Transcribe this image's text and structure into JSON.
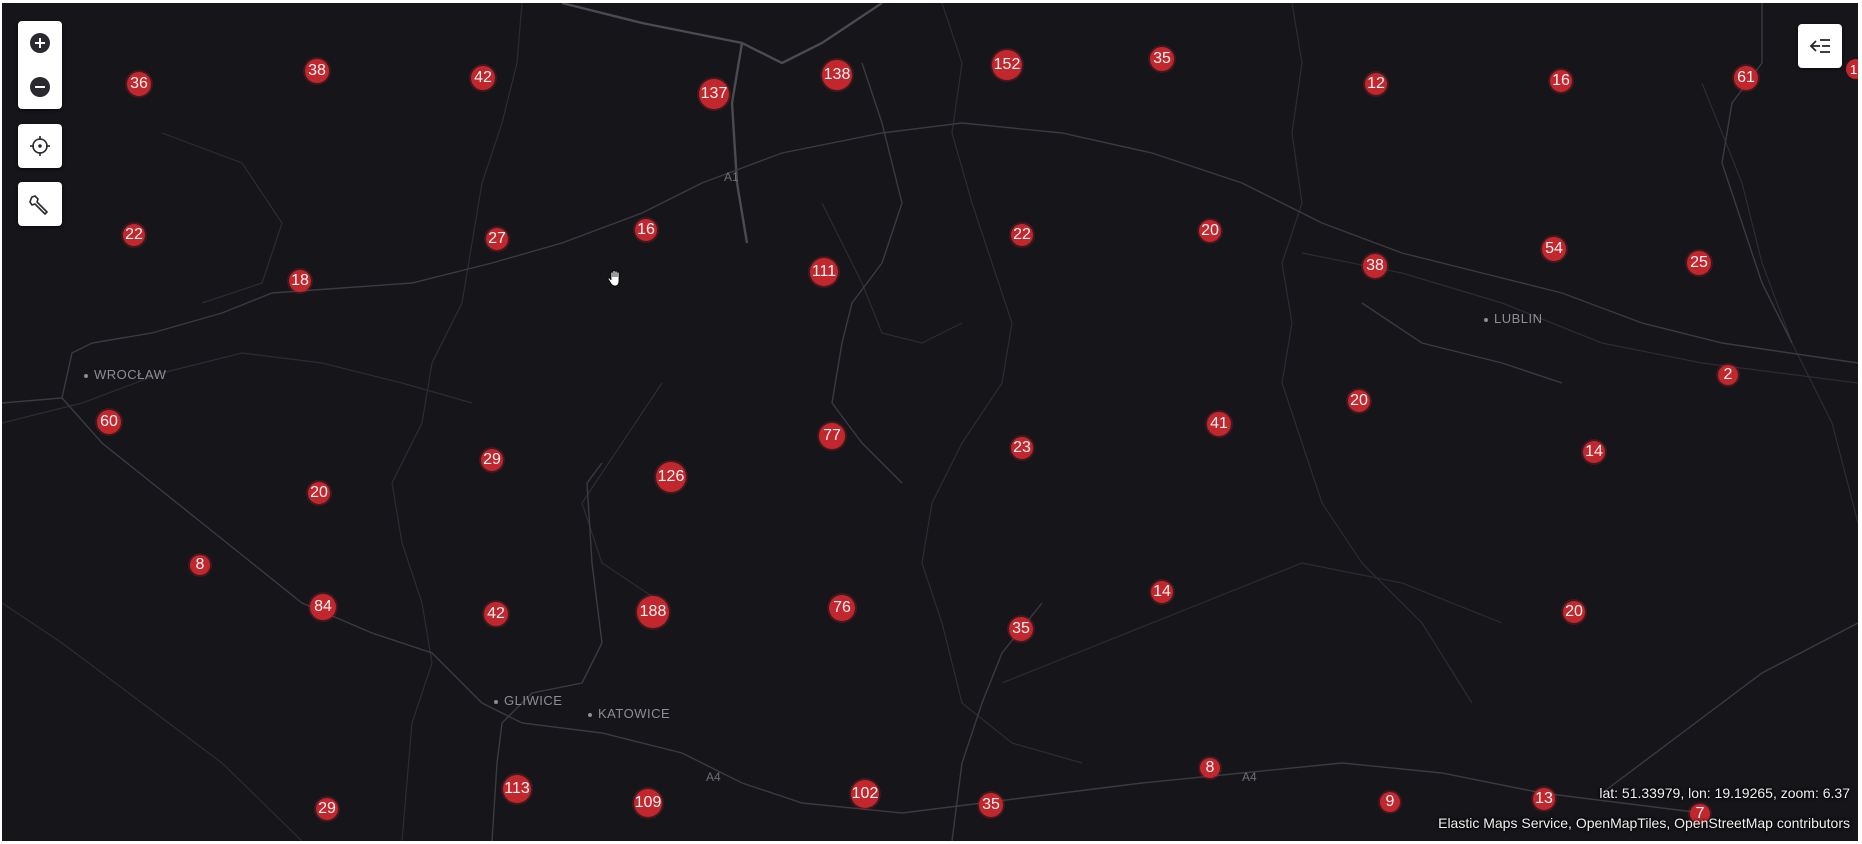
{
  "controls": {
    "zoom_in": "zoom-in-icon",
    "zoom_out": "zoom-out-icon",
    "locate": "crosshair-icon",
    "tools": "wrench-icon",
    "layers": "layers-toggle-icon"
  },
  "cities": [
    {
      "name": "WROCŁAW"
    },
    {
      "name": "LUBLIN"
    },
    {
      "name": "GLIWICE"
    },
    {
      "name": "KATOWICE"
    }
  ],
  "road_labels": [
    "A1",
    "A4",
    "A4"
  ],
  "clusters": [
    {
      "label": "36"
    },
    {
      "label": "38"
    },
    {
      "label": "42"
    },
    {
      "label": "137"
    },
    {
      "label": "138"
    },
    {
      "label": "152"
    },
    {
      "label": "35"
    },
    {
      "label": "12"
    },
    {
      "label": "16"
    },
    {
      "label": "61"
    },
    {
      "label": "22"
    },
    {
      "label": "27"
    },
    {
      "label": "16"
    },
    {
      "label": "18"
    },
    {
      "label": "111"
    },
    {
      "label": "22"
    },
    {
      "label": "20"
    },
    {
      "label": "38"
    },
    {
      "label": "54"
    },
    {
      "label": "25"
    },
    {
      "label": "2"
    },
    {
      "label": "60"
    },
    {
      "label": "29"
    },
    {
      "label": "126"
    },
    {
      "label": "77"
    },
    {
      "label": "23"
    },
    {
      "label": "41"
    },
    {
      "label": "20"
    },
    {
      "label": "14"
    },
    {
      "label": "20"
    },
    {
      "label": "8"
    },
    {
      "label": "84"
    },
    {
      "label": "42"
    },
    {
      "label": "188"
    },
    {
      "label": "76"
    },
    {
      "label": "35"
    },
    {
      "label": "14"
    },
    {
      "label": "20"
    },
    {
      "label": "113"
    },
    {
      "label": "109"
    },
    {
      "label": "102"
    },
    {
      "label": "35"
    },
    {
      "label": "8"
    },
    {
      "label": "9"
    },
    {
      "label": "13"
    },
    {
      "label": "7"
    },
    {
      "label": "29"
    }
  ],
  "edge_cluster": "1",
  "status": {
    "coordinates": "lat: 51.33979, lon: 19.19265, zoom: 6.37",
    "attribution": "Elastic Maps Service, OpenMapTiles, OpenStreetMap contributors"
  },
  "colors": {
    "map_background": "#15151a",
    "cluster_fill": "#c1272d",
    "control_background": "#ffffff"
  }
}
